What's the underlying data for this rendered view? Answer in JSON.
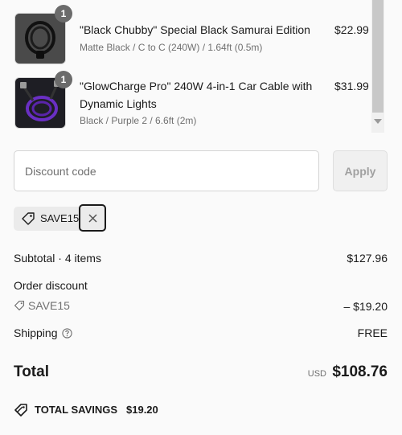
{
  "cart": {
    "items": [
      {
        "quantity": "1",
        "title": "\"Black Chubby\" Special Black Samurai Edition",
        "variant": "Matte Black / C to C (240W) / 1.64ft (0.5m)",
        "price": "$22.99",
        "image_icon": "black-coiled-cable"
      },
      {
        "quantity": "1",
        "title": "\"GlowCharge Pro\" 240W 4-in-1 Car Cable with Dynamic Lights",
        "variant": "Black / Purple 2 / 6.6ft (2m)",
        "price": "$31.99",
        "image_icon": "purple-glow-cable"
      }
    ]
  },
  "discount": {
    "placeholder": "Discount code",
    "apply_label": "Apply",
    "applied_code": "SAVE15"
  },
  "summary": {
    "subtotal_label": "Subtotal · 4 items",
    "subtotal_value": "$127.96",
    "order_discount_label": "Order discount",
    "discount_code": "SAVE15",
    "discount_value": "– $19.20",
    "shipping_label": "Shipping",
    "shipping_value": "FREE",
    "total_label": "Total",
    "total_currency": "USD",
    "total_value": "$108.76",
    "savings_label": "TOTAL SAVINGS",
    "savings_value": "$19.20"
  },
  "colors": {
    "background": "#fafafa",
    "badge": "#6b6b6b",
    "muted_text": "#707070",
    "product_accent_purple": "#6a2fc4"
  }
}
